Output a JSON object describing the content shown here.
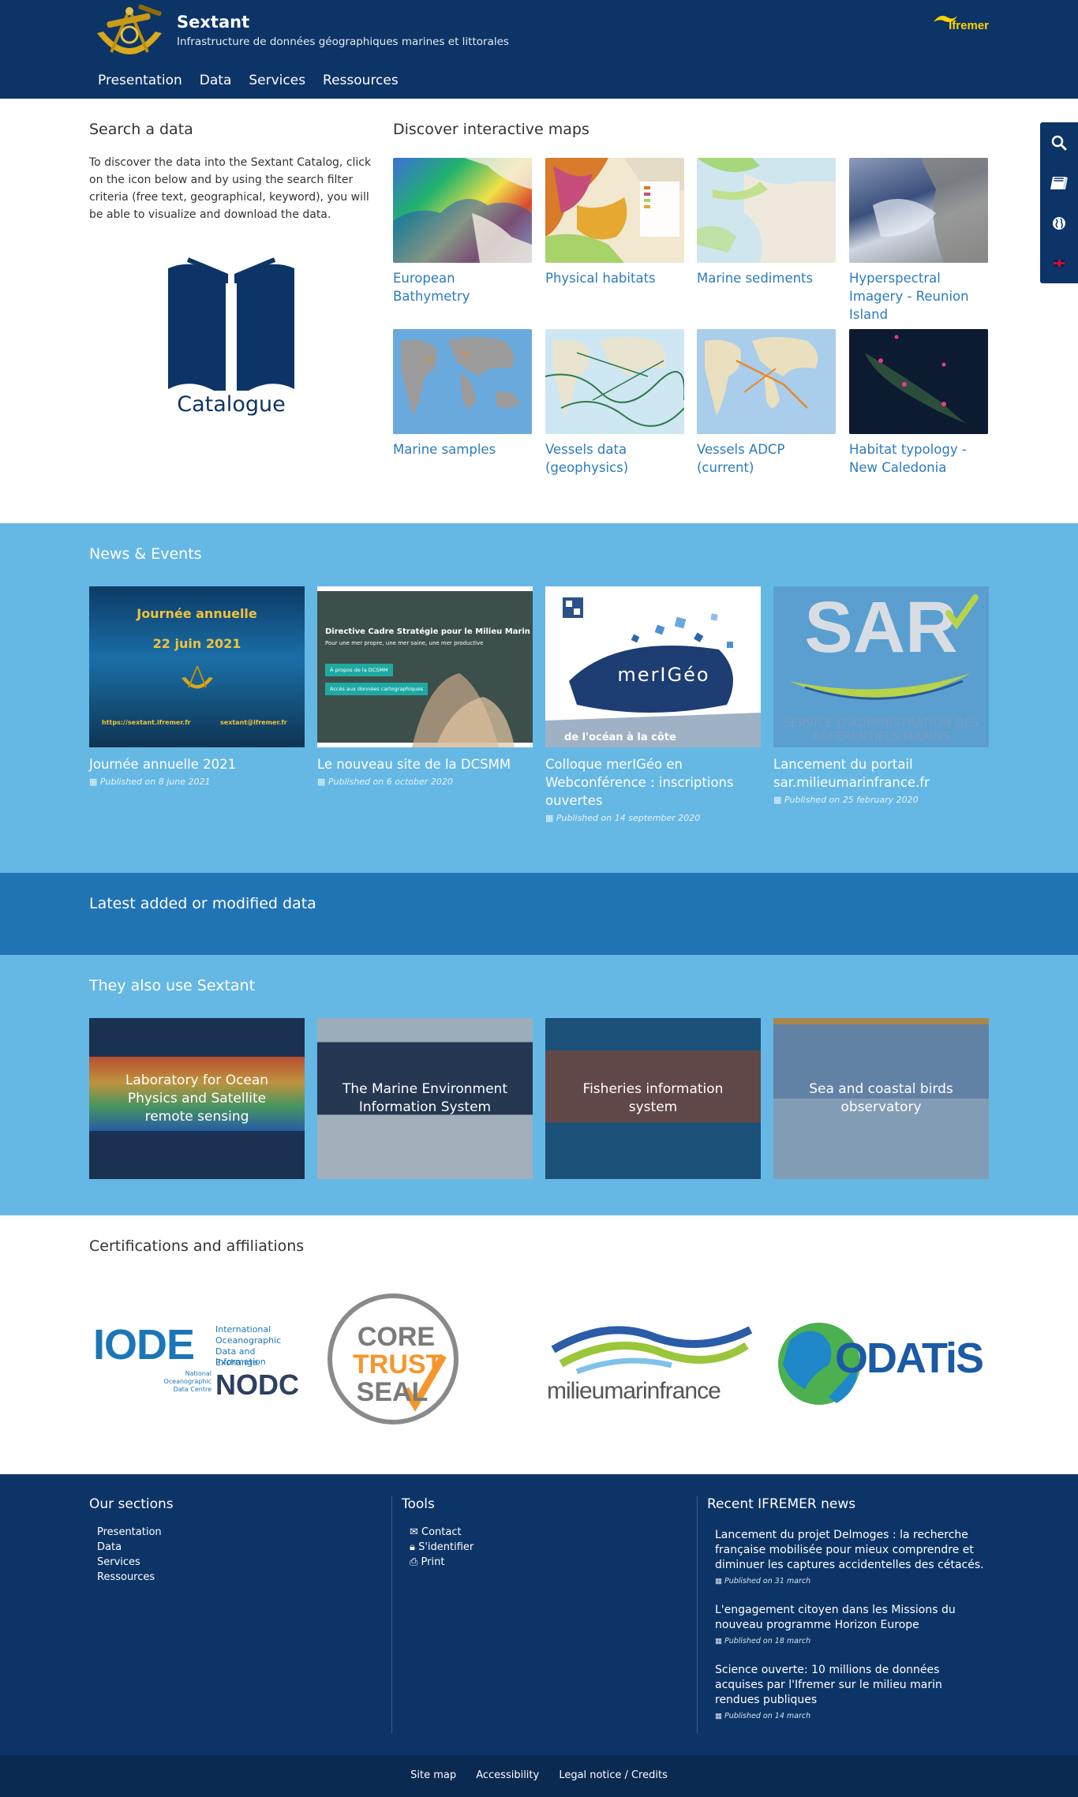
{
  "header": {
    "title": "Sextant",
    "subtitle": "Infrastructure de données géographiques marines et littorales",
    "partner_logo": "Ifremer",
    "nav": [
      "Presentation",
      "Data",
      "Services",
      "Ressources"
    ]
  },
  "sidebar": {
    "icons": [
      "search-icon",
      "book-icon",
      "globe-icon",
      "uk-flag-icon"
    ]
  },
  "search": {
    "title": "Search a data",
    "text": "To discover the data into the Sextant Catalog, click on the icon below and by using the search filter criteria (free text, geographical, keyword), you will be able to visualize and download the data.",
    "catalogue_label": "Catalogue"
  },
  "maps": {
    "title": "Discover interactive maps",
    "items": [
      {
        "label": "European Bathymetry"
      },
      {
        "label": "Physical habitats"
      },
      {
        "label": "Marine sediments"
      },
      {
        "label": "Hyperspectral Imagery - Reunion Island"
      },
      {
        "label": "Marine samples"
      },
      {
        "label": "Vessels data (geophysics)"
      },
      {
        "label": "Vessels ADCP (current)"
      },
      {
        "label": "Habitat typology - New Caledonia"
      }
    ]
  },
  "news": {
    "title": "News & Events",
    "items": [
      {
        "title": "Journée annuelle 2021",
        "date": "Published on 8 june 2021",
        "img_text_1": "Journée annuelle",
        "img_text_2": "22 juin 2021",
        "img_text_3": "https://sextant.ifremer.fr",
        "img_text_4": "sextant@ifremer.fr"
      },
      {
        "title": "Le nouveau site de la DCSMM",
        "date": "Published on 6 october 2020",
        "img_text_1": "Directive Cadre Stratégie pour le Milieu Marin",
        "img_text_2": "Pour une mer propre, une mer saine, une mer productive",
        "img_text_3": "À propos de la DCSMM",
        "img_text_4": "Accès aux données cartographiques"
      },
      {
        "title": "Colloque merIGéo en Webconférence : inscriptions ouvertes",
        "date": "Published on 14 september 2020",
        "img_text_1": "merIGéo",
        "img_text_2": "de l'océan à la côte"
      },
      {
        "title": "Lancement du portail sar.milieumarinfrance.fr",
        "date": "Published on 25 february 2020",
        "img_text_1": "SAR",
        "img_text_2": "SERVICE D'ADMINISTRATION DES RÉFÉRENTIELS MARINS"
      }
    ]
  },
  "latest": {
    "title": "Latest added or modified data"
  },
  "alsouse": {
    "title": "They also use Sextant",
    "items": [
      {
        "label": "Laboratory for Ocean Physics and Satellite remote sensing"
      },
      {
        "label": "The Marine Environment Information System"
      },
      {
        "label": "Fisheries information system"
      },
      {
        "label": "Sea and coastal birds observatory"
      }
    ]
  },
  "certifications": {
    "title": "Certifications and affiliations",
    "logos": [
      {
        "l1": "IODE",
        "l2": "International",
        "l3": "Oceanographic",
        "l4": "Data and Information",
        "l5": "Exchange",
        "l6": "National",
        "l7": "Oceanographic",
        "l8": "Data Centre",
        "l9": "NODC"
      },
      {
        "l1": "CORE",
        "l2": "TRUST",
        "l3": "SEAL"
      },
      {
        "l1": "milieumarinfrance"
      },
      {
        "l1": "ODATiS"
      }
    ]
  },
  "footer": {
    "sections_title": "Our sections",
    "sections": [
      "Presentation",
      "Data",
      "Services",
      "Ressources"
    ],
    "tools_title": "Tools",
    "tools": [
      "Contact",
      "S'identifier",
      "Print"
    ],
    "news_title": "Recent IFREMER news",
    "news": [
      {
        "title": "Lancement du projet Delmoges : la recherche française mobilisée pour mieux comprendre et diminuer les captures accidentelles des cétacés.",
        "date": "Published on 31 march"
      },
      {
        "title": "L'engagement citoyen dans les Missions du nouveau programme Horizon Europe",
        "date": "Published on 18 march"
      },
      {
        "title": "Science ouverte: 10 millions de données acquises par l'Ifremer sur le milieu marin rendues publiques",
        "date": "Published on 14 march"
      }
    ],
    "bottom_links": [
      "Site map",
      "Accessibility",
      "Legal notice / Credits"
    ]
  },
  "colors": {
    "navy": "#0c3466",
    "light_blue": "#66b8e4",
    "mid_blue": "#2174b4",
    "link_blue": "#2b7bbd"
  }
}
